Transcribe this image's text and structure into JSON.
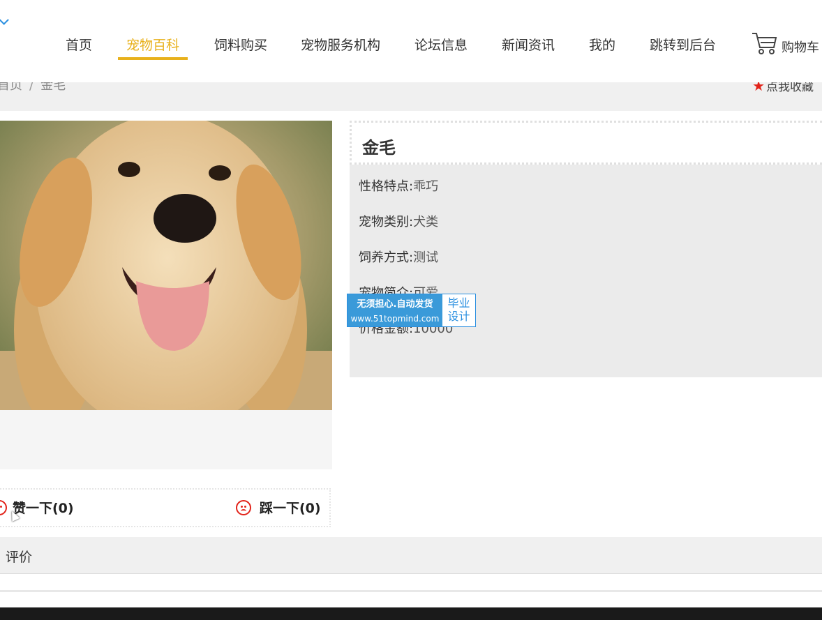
{
  "nav": {
    "items": [
      {
        "label": "首页"
      },
      {
        "label": "宠物百科"
      },
      {
        "label": "饲料购买"
      },
      {
        "label": "宠物服务机构"
      },
      {
        "label": "论坛信息"
      },
      {
        "label": "新闻资讯"
      },
      {
        "label": "我的"
      },
      {
        "label": "跳转到后台"
      }
    ],
    "active_index": 1,
    "cart_label": "购物车"
  },
  "breadcrumb": {
    "home": "首页",
    "sep": "/",
    "current": "金毛"
  },
  "favorite_label": "点我收藏",
  "pet": {
    "name": "金毛",
    "fields": [
      {
        "label": "性格特点:",
        "value": "乖巧"
      },
      {
        "label": "宠物类别:",
        "value": "犬类"
      },
      {
        "label": "饲养方式:",
        "value": "测试"
      },
      {
        "label": "宠物简介:",
        "value": "可爱"
      },
      {
        "label": "价格金额:",
        "value": "10000"
      }
    ]
  },
  "votes": {
    "like": "赞一下(0)",
    "dislike": "踩一下(0)"
  },
  "watermark": {
    "line1": "无须担心.自动发货",
    "line2": "www.51topmind.com",
    "right1": "毕业",
    "right2": "设计"
  },
  "review_title": "评价",
  "colors": {
    "accent": "#e8b11c",
    "star": "#e2231a",
    "panel": "#ebebeb"
  }
}
